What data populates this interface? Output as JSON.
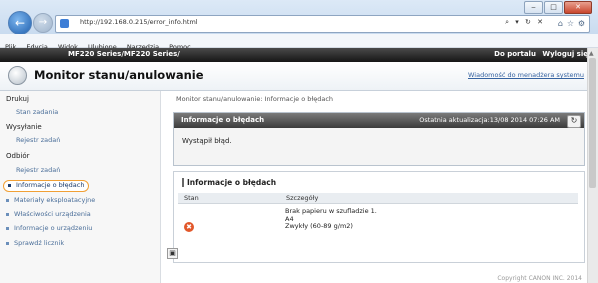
{
  "browser": {
    "url": "http://192.168.0.215/error_info.html",
    "addr_tools": "⌕ ▾ ↻ ✕",
    "back_icon": "←",
    "forward_icon": "→",
    "home_icon": "⌂",
    "fav_icon": "☆",
    "settings_icon": "⚙",
    "win_min": "‒",
    "win_max": "□",
    "win_close": "✕",
    "menu": [
      "Plik",
      "Edycja",
      "Widok",
      "Ulubione",
      "Narzędzia",
      "Pomoc"
    ]
  },
  "header": {
    "model": "MF220 Series/MF220 Series/",
    "portal_link": "Do portalu",
    "logout": "Wyloguj się",
    "page_title": "Monitor stanu/anulowanie",
    "mail_link": "Wiadomość do menadżera systemu"
  },
  "sidebar": {
    "sections": [
      {
        "title": "Drukuj",
        "items": [
          "Stan zadania"
        ]
      },
      {
        "title": "Wysyłanie",
        "items": [
          "Rejestr zadań"
        ]
      },
      {
        "title": "Odbiór",
        "items": [
          "Rejestr zadań"
        ]
      }
    ],
    "bullets": [
      "Informacje o błędach",
      "Materiały eksploatacyjne",
      "Właściwości urządzenia",
      "Informacje o urządzeniu",
      "Sprawdź licznik"
    ],
    "active_index": 0
  },
  "main": {
    "breadcrumb": "Monitor stanu/anulowanie: Informacje o błędach",
    "panel_title": "Informacje o błędach",
    "last_update": "Ostatnia aktualizacja:13/08 2014 07:26 AM",
    "refresh_icon": "↻",
    "status_message": "Wystąpił błąd.",
    "section_title": "Informacje o błędach",
    "table": {
      "headers": [
        "Stan",
        "Szczegóły"
      ],
      "rows": [
        {
          "status_icon": "✖",
          "details": [
            "Brak papieru w szufladzie 1.",
            "A4",
            "Zwykły (60-89 g/m2)"
          ]
        }
      ]
    },
    "small_btn": "▣",
    "copyright": "Copyright CANON INC. 2014"
  }
}
